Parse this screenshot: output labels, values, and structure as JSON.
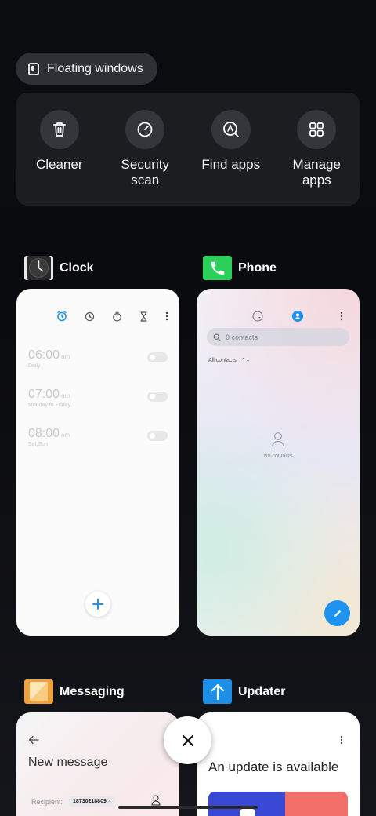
{
  "floating_windows": {
    "label": "Floating windows",
    "icon": "floating-window-icon"
  },
  "quick_actions": [
    {
      "id": "cleaner",
      "label": "Cleaner",
      "icon": "trash-icon"
    },
    {
      "id": "security",
      "label": "Security scan",
      "icon": "gauge-icon"
    },
    {
      "id": "findapps",
      "label": "Find apps",
      "icon": "search-app-icon"
    },
    {
      "id": "manage",
      "label": "Manage apps",
      "icon": "grid-icon"
    }
  ],
  "apps": {
    "clock": {
      "name": "Clock",
      "alarms": [
        {
          "time": "06:00",
          "ampm": "am",
          "repeat": "Daily"
        },
        {
          "time": "07:00",
          "ampm": "am",
          "repeat": "Monday to Friday"
        },
        {
          "time": "08:00",
          "ampm": "am",
          "repeat": "Sat,Sun"
        }
      ]
    },
    "phone": {
      "name": "Phone",
      "search_placeholder": "0 contacts",
      "filter_label": "All contacts",
      "empty_text": "No contacts"
    },
    "messaging": {
      "name": "Messaging",
      "title": "New message",
      "recipient_label": "Recipient:",
      "recipient_value": "18730218809",
      "chip_close": "×"
    },
    "updater": {
      "name": "Updater",
      "title": "An update is available"
    }
  },
  "colors": {
    "accent_blue": "#1d93ef",
    "phone_green": "#2bd05a",
    "messaging_orange": "#f1a23a",
    "updater_blue": "#1e8fe6"
  }
}
